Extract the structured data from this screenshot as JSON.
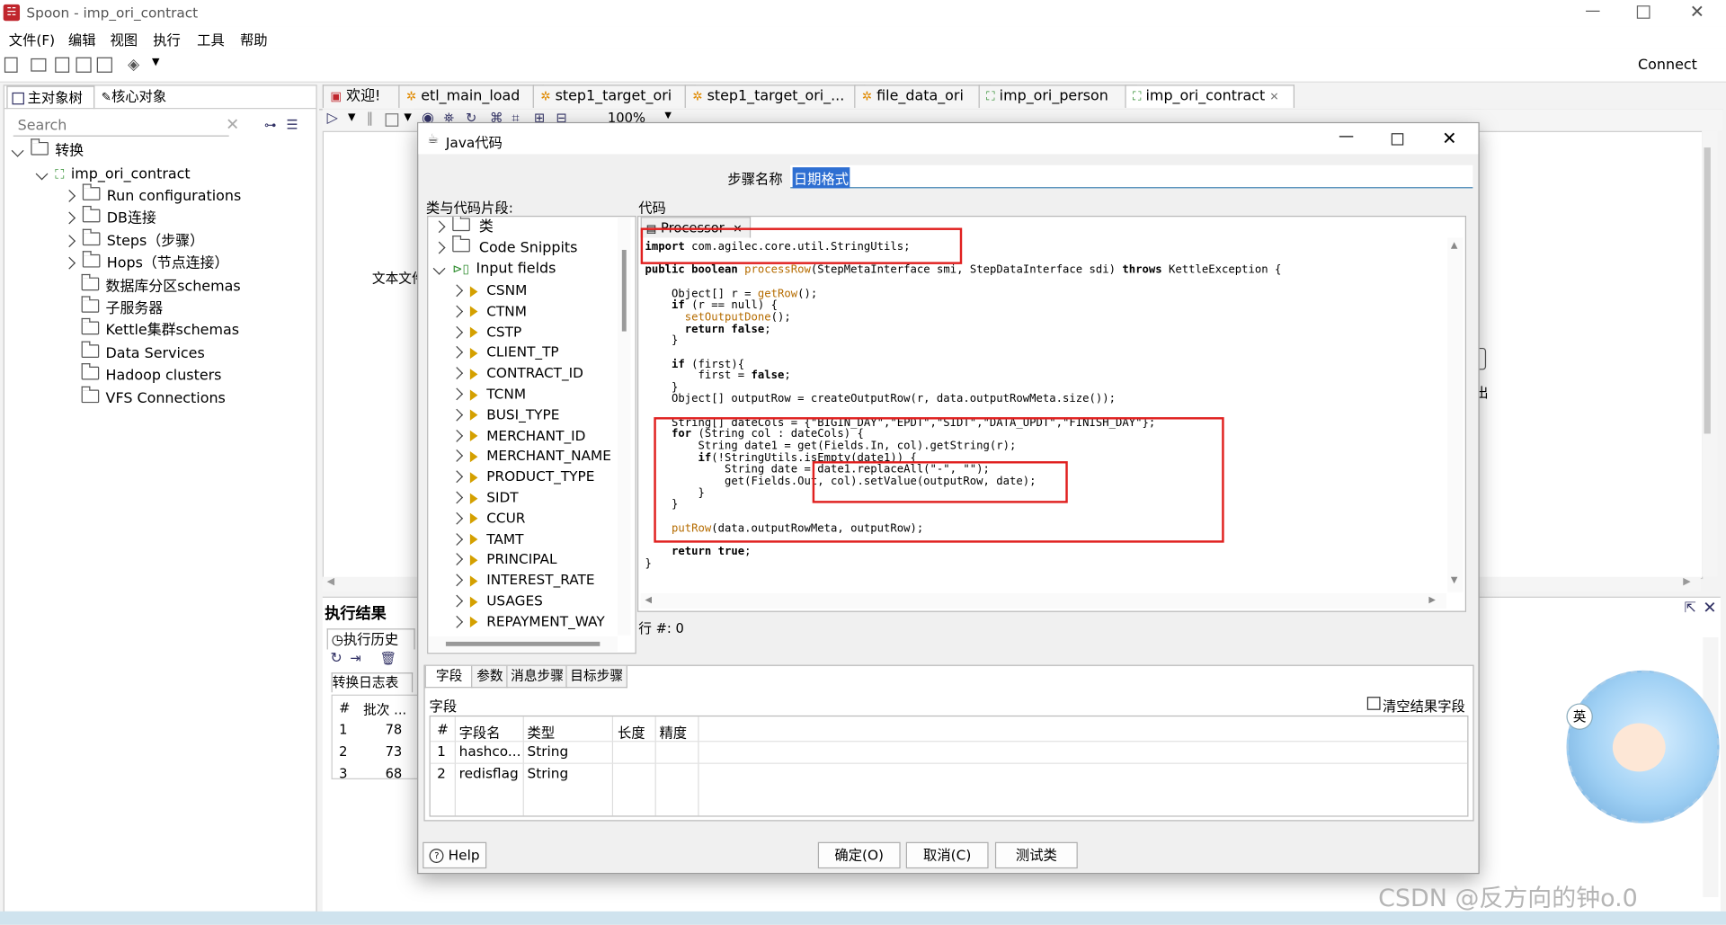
{
  "window": {
    "title": "Spoon - imp_ori_contract",
    "connect": "Connect"
  },
  "menu": [
    "文件(F)",
    "编辑",
    "视图",
    "执行",
    "工具",
    "帮助"
  ],
  "left_tabs": [
    "主对象树",
    "核心对象"
  ],
  "search": {
    "placeholder": "Search"
  },
  "tree": {
    "root": "转换",
    "transform": "imp_ori_contract",
    "items": [
      "Run configurations",
      "DB连接",
      "Steps（步骤）",
      "Hops（节点连接）",
      "数据库分区schemas",
      "子服务器",
      "Kettle集群schemas",
      "Data Services",
      "Hadoop clusters",
      "VFS Connections"
    ]
  },
  "editor_tabs": [
    "欢迎!",
    "etl_main_load",
    "step1_target_ori",
    "step1_target_ori_...",
    "file_data_ori",
    "imp_ori_person",
    "imp_ori_contract"
  ],
  "editor_toolbar": {
    "zoom": "100%"
  },
  "canvas": {
    "partial_label_left": "文本文件",
    "partial_label_right": "出"
  },
  "results": {
    "title": "执行结果",
    "tab": "执行历史",
    "log_tab": "转换日志表",
    "col_hash": "#",
    "col_batch": "批次 ...",
    "rows": [
      {
        "n": "1",
        "batch": "78"
      },
      {
        "n": "2",
        "batch": "73"
      },
      {
        "n": "3",
        "batch": "68"
      }
    ]
  },
  "dialog": {
    "title": "Java代码",
    "step_name_label": "步骤名称",
    "step_name_value": "日期格式",
    "classes_label": "类与代码片段:",
    "code_label": "代码",
    "code_tab": "Processor",
    "row_label": "行 #: 0",
    "class_tree": {
      "classes": "类",
      "snippets": "Code Snippits",
      "input_fields": "Input fields"
    },
    "fields": [
      "CSNM",
      "CTNM",
      "CSTP",
      "CLIENT_TP",
      "CONTRACT_ID",
      "TCNM",
      "BUSI_TYPE",
      "MERCHANT_ID",
      "MERCHANT_NAME",
      "PRODUCT_TYPE",
      "SIDT",
      "CCUR",
      "TAMT",
      "PRINCIPAL",
      "INTEREST_RATE",
      "USAGES",
      "REPAYMENT_WAY"
    ],
    "code_lines": [
      "import com.agilec.core.util.StringUtils;",
      "",
      "public boolean processRow(StepMetaInterface smi, StepDataInterface sdi) throws KettleException {",
      "",
      "    Object[] r = getRow();",
      "    if (r == null) {",
      "      setOutputDone();",
      "      return false;",
      "    }",
      "",
      "    if (first){",
      "        first = false;",
      "    }",
      "    Object[] outputRow = createOutputRow(r, data.outputRowMeta.size());",
      "",
      "    String[] dateCols = {\"BIGIN_DAY\",\"EPDT\",\"SIDT\",\"DATA_UPDT\",\"FINISH_DAY\"};",
      "    for (String col : dateCols) {",
      "        String date1 = get(Fields.In, col).getString(r);",
      "        if(!StringUtils.isEmpty(date1)) {",
      "            String date = date1.replaceAll(\"-\", \"\");",
      "            get(Fields.Out, col).setValue(outputRow, date);",
      "        }",
      "    }",
      "",
      "    putRow(data.outputRowMeta, outputRow);",
      "",
      "    return true;",
      "}"
    ],
    "bottom_tabs": [
      "字段",
      "参数",
      "消息步骤",
      "目标步骤"
    ],
    "fields_label": "字段",
    "clear_label": "清空结果字段",
    "table_headers": [
      "#",
      "字段名",
      "类型",
      "长度",
      "精度"
    ],
    "table_rows": [
      {
        "n": "1",
        "name": "hashco...",
        "type": "String",
        "len": "",
        "prec": ""
      },
      {
        "n": "2",
        "name": "redisflag",
        "type": "String",
        "len": "",
        "prec": ""
      }
    ],
    "help": "Help",
    "ok": "确定(O)",
    "cancel": "取消(C)",
    "test": "测试类"
  },
  "watermark": "CSDN @反方向的钟o.0",
  "avatar_badge": "英"
}
